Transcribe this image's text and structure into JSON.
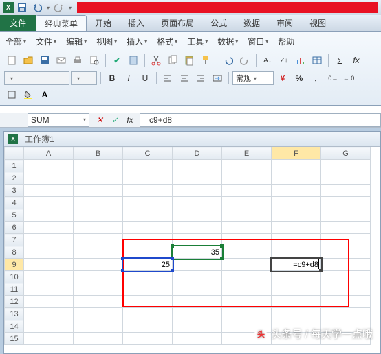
{
  "app": {
    "icon": "X"
  },
  "qat": {
    "save": "save",
    "undo": "undo",
    "redo": "redo"
  },
  "tabs": {
    "file": "文件",
    "items": [
      {
        "label": "经典菜单",
        "active": true
      },
      {
        "label": "开始"
      },
      {
        "label": "插入"
      },
      {
        "label": "页面布局"
      },
      {
        "label": "公式"
      },
      {
        "label": "数据"
      },
      {
        "label": "审阅"
      },
      {
        "label": "视图"
      }
    ]
  },
  "menus": [
    {
      "label": "全部"
    },
    {
      "label": "文件"
    },
    {
      "label": "编辑"
    },
    {
      "label": "视图"
    },
    {
      "label": "插入"
    },
    {
      "label": "格式"
    },
    {
      "label": "工具"
    },
    {
      "label": "数据"
    },
    {
      "label": "窗口"
    },
    {
      "label": "帮助"
    }
  ],
  "toolbar2": {
    "normal": "常规"
  },
  "namebox": {
    "value": "SUM"
  },
  "formula": {
    "value": "=c9+d8"
  },
  "workbook": {
    "title": "工作簿1"
  },
  "columns": [
    "A",
    "B",
    "C",
    "D",
    "E",
    "F",
    "G"
  ],
  "rows": [
    "1",
    "2",
    "3",
    "4",
    "5",
    "6",
    "7",
    "8",
    "9",
    "10",
    "11",
    "12",
    "13",
    "14",
    "15"
  ],
  "cells": {
    "C9": "25",
    "D8": "35",
    "F9": "=c9+d8"
  },
  "active": {
    "row": "9",
    "col": "F"
  },
  "watermark": "头条号 / 每天学一点哦"
}
